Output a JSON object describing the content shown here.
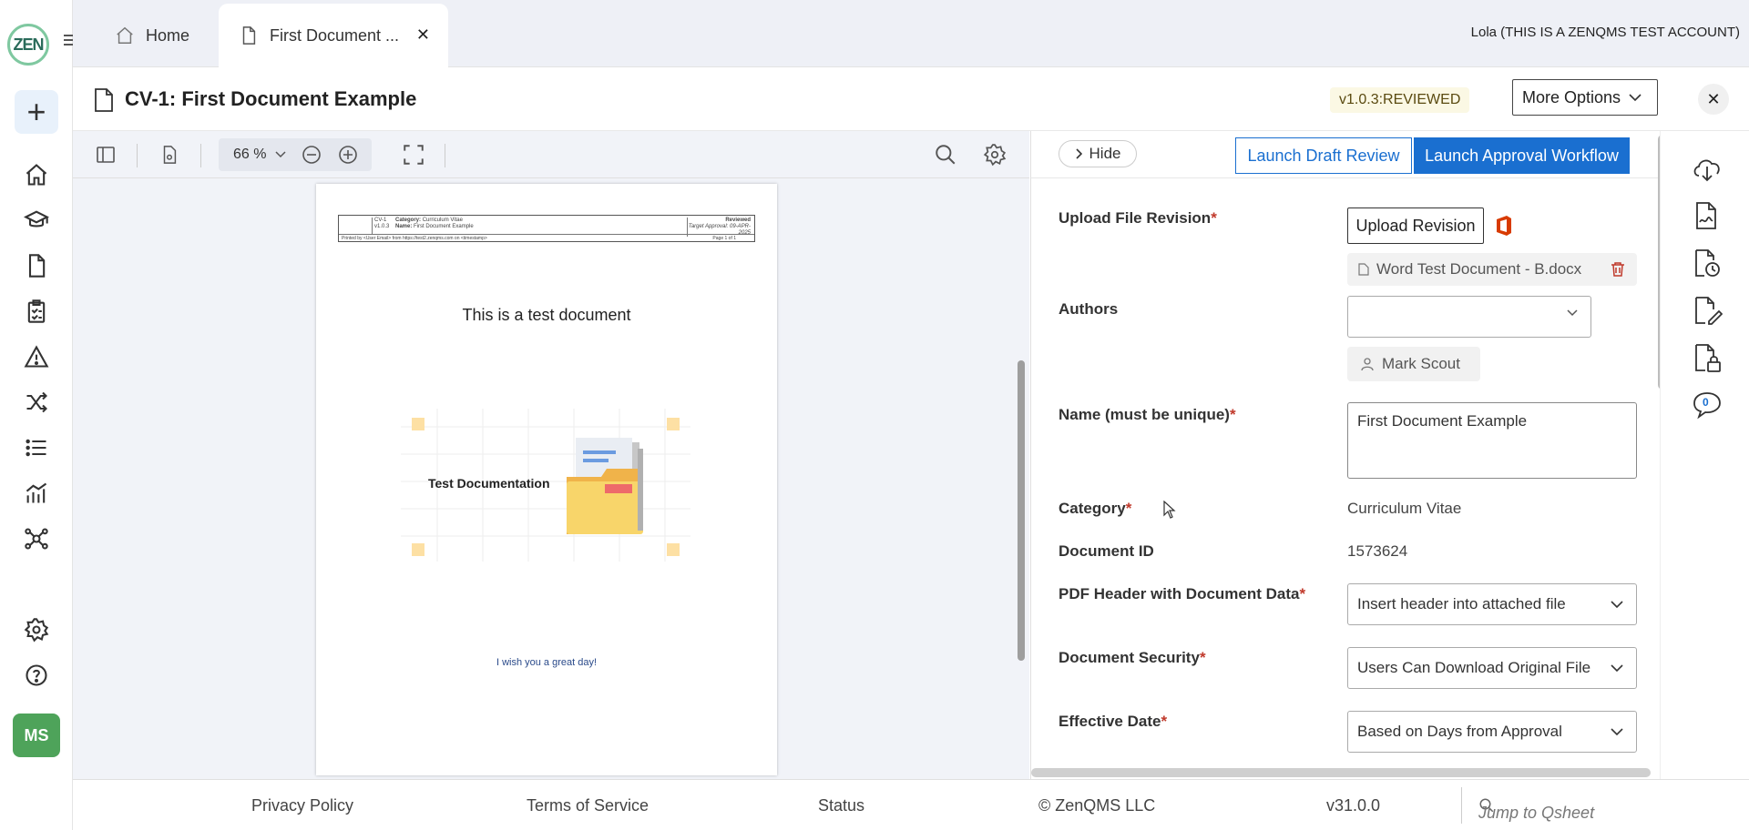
{
  "app": {
    "logo_text": "ZEN",
    "user_initials": "MS",
    "user_name": "Lola (THIS IS A ZENQMS TEST ACCOUNT)"
  },
  "tabs": [
    {
      "label": "Home"
    },
    {
      "label": "First Document ..."
    }
  ],
  "document": {
    "title": "CV-1: First Document Example",
    "version_badge": "v1.0.3:REVIEWED",
    "more_options_label": "More Options"
  },
  "viewer": {
    "zoom": "66 %",
    "page_header": {
      "doc_id": "CV-1",
      "version": "v1.0.3",
      "category_label": "Category:",
      "category": "Curriculum Vitae",
      "name_label": "Name:",
      "name": "First Document Example",
      "status": "Reviewed",
      "target": "Target Approval: 09-APR-2025",
      "printed": "Printed by <User Email> from https://test2.zenqms.com on <timestamp>",
      "page": "Page 1 of 1"
    },
    "heading": "This is a test document",
    "illustration_label": "Test Documentation",
    "footer_text": "I wish you a great day!"
  },
  "panel": {
    "hide_label": "Hide",
    "draft_review_label": "Launch Draft Review",
    "approval_workflow_label": "Launch Approval Workflow",
    "fields": {
      "upload": {
        "label": "Upload File Revision",
        "button": "Upload Revision",
        "file": "Word Test Document - B.docx"
      },
      "authors": {
        "label": "Authors",
        "value": "",
        "chip": "Mark Scout"
      },
      "name": {
        "label": "Name (must be unique)",
        "value": "First Document Example"
      },
      "category": {
        "label": "Category",
        "value": "Curriculum Vitae"
      },
      "document_id": {
        "label": "Document ID",
        "value": "1573624"
      },
      "pdf_header": {
        "label": "PDF Header with Document Data",
        "value": "Insert header into attached file"
      },
      "security": {
        "label": "Document Security",
        "value": "Users Can Download Original File"
      },
      "effective_date": {
        "label": "Effective Date",
        "value": "Based on Days from Approval"
      }
    }
  },
  "right_rail": {
    "comment_count": "0"
  },
  "footer": {
    "privacy": "Privacy Policy",
    "terms": "Terms of Service",
    "status": "Status",
    "copyright": "© ZenQMS LLC",
    "version": "v31.0.0",
    "jump_placeholder": "Jump to Qsheet"
  },
  "colors": {
    "primary": "#1a6fd0",
    "required": "#c0392b",
    "avatar": "#4ea35a"
  }
}
